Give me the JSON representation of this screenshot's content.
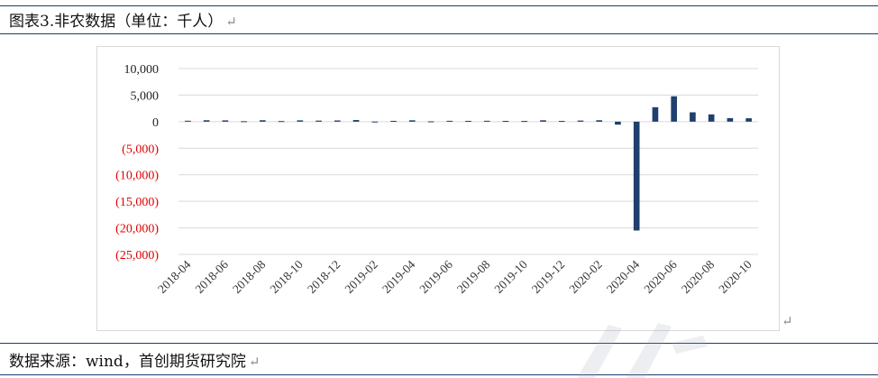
{
  "figure": {
    "title": "图表3.非农数据（单位：千人）",
    "source": "数据来源：wind，首创期货研究院",
    "return_mark": "↵"
  },
  "chart_data": {
    "type": "bar",
    "title": "",
    "xlabel": "",
    "ylabel": "",
    "ylim": [
      -25000,
      10000
    ],
    "y_ticks": [
      10000,
      5000,
      0,
      -5000,
      -10000,
      -15000,
      -20000,
      -25000
    ],
    "y_tick_labels": [
      "10,000",
      "5,000",
      "0",
      "(5,000)",
      "(10,000)",
      "(15,000)",
      "(20,000)",
      "(25,000)"
    ],
    "negative_label_color": "#e00000",
    "positive_label_color": "#222222",
    "bar_color": "#1f3f6e",
    "grid": true,
    "grid_color": "#d9d9d9",
    "x_tick_labels": [
      "2018-04",
      "2018-06",
      "2018-08",
      "2018-10",
      "2018-12",
      "2019-02",
      "2019-04",
      "2019-06",
      "2019-08",
      "2019-10",
      "2019-12",
      "2020-02",
      "2020-04",
      "2020-06",
      "2020-08",
      "2020-10"
    ],
    "categories": [
      "2018-04",
      "2018-05",
      "2018-06",
      "2018-07",
      "2018-08",
      "2018-09",
      "2018-10",
      "2018-11",
      "2018-12",
      "2019-01",
      "2019-02",
      "2019-03",
      "2019-04",
      "2019-05",
      "2019-06",
      "2019-07",
      "2019-08",
      "2019-09",
      "2019-10",
      "2019-11",
      "2019-12",
      "2020-01",
      "2020-02",
      "2020-03",
      "2020-04",
      "2020-05",
      "2020-06",
      "2020-07",
      "2020-08",
      "2020-09",
      "2020-10"
    ],
    "values": [
      175,
      270,
      245,
      80,
      270,
      110,
      250,
      200,
      230,
      310,
      20,
      150,
      260,
      60,
      160,
      150,
      170,
      140,
      130,
      260,
      140,
      210,
      270,
      -560,
      -20500,
      2720,
      4780,
      1760,
      1370,
      660,
      640
    ]
  }
}
